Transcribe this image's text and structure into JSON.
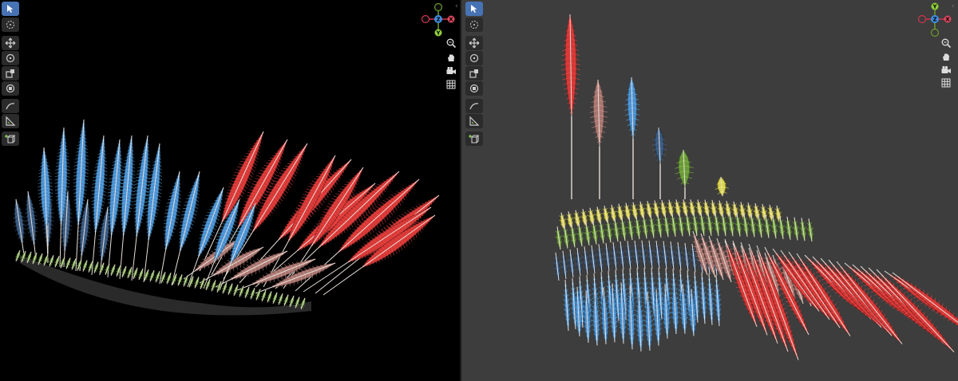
{
  "viewports": [
    {
      "name": "left",
      "background": "#000000",
      "toolbar": [
        "select-box",
        "cursor",
        "move",
        "rotate",
        "scale",
        "transform",
        "annotate",
        "measure",
        "add-cube"
      ],
      "gizmo": {
        "x": "X",
        "y": "Y",
        "z": "Z"
      },
      "navigation": [
        "zoom",
        "pan",
        "camera",
        "ortho-grid"
      ]
    },
    {
      "name": "right",
      "background": "#3d3d3d",
      "toolbar": [
        "select-box",
        "cursor",
        "move",
        "rotate",
        "scale",
        "transform",
        "annotate",
        "measure",
        "add-cube"
      ],
      "gizmo": {
        "x": "X",
        "y": "Y",
        "z": "Z"
      },
      "navigation": [
        "zoom",
        "pan",
        "camera",
        "ortho-grid"
      ]
    }
  ],
  "feather_colors": {
    "red": "#d43836",
    "blue": "#4a8fd0",
    "brown": "#a87670",
    "navy": "#3a5a80",
    "green": "#6a9a38",
    "yellow": "#d8d048",
    "accent": "#4772b3"
  },
  "feather_samples": [
    "red",
    "brown",
    "blue",
    "navy",
    "green",
    "yellow"
  ]
}
